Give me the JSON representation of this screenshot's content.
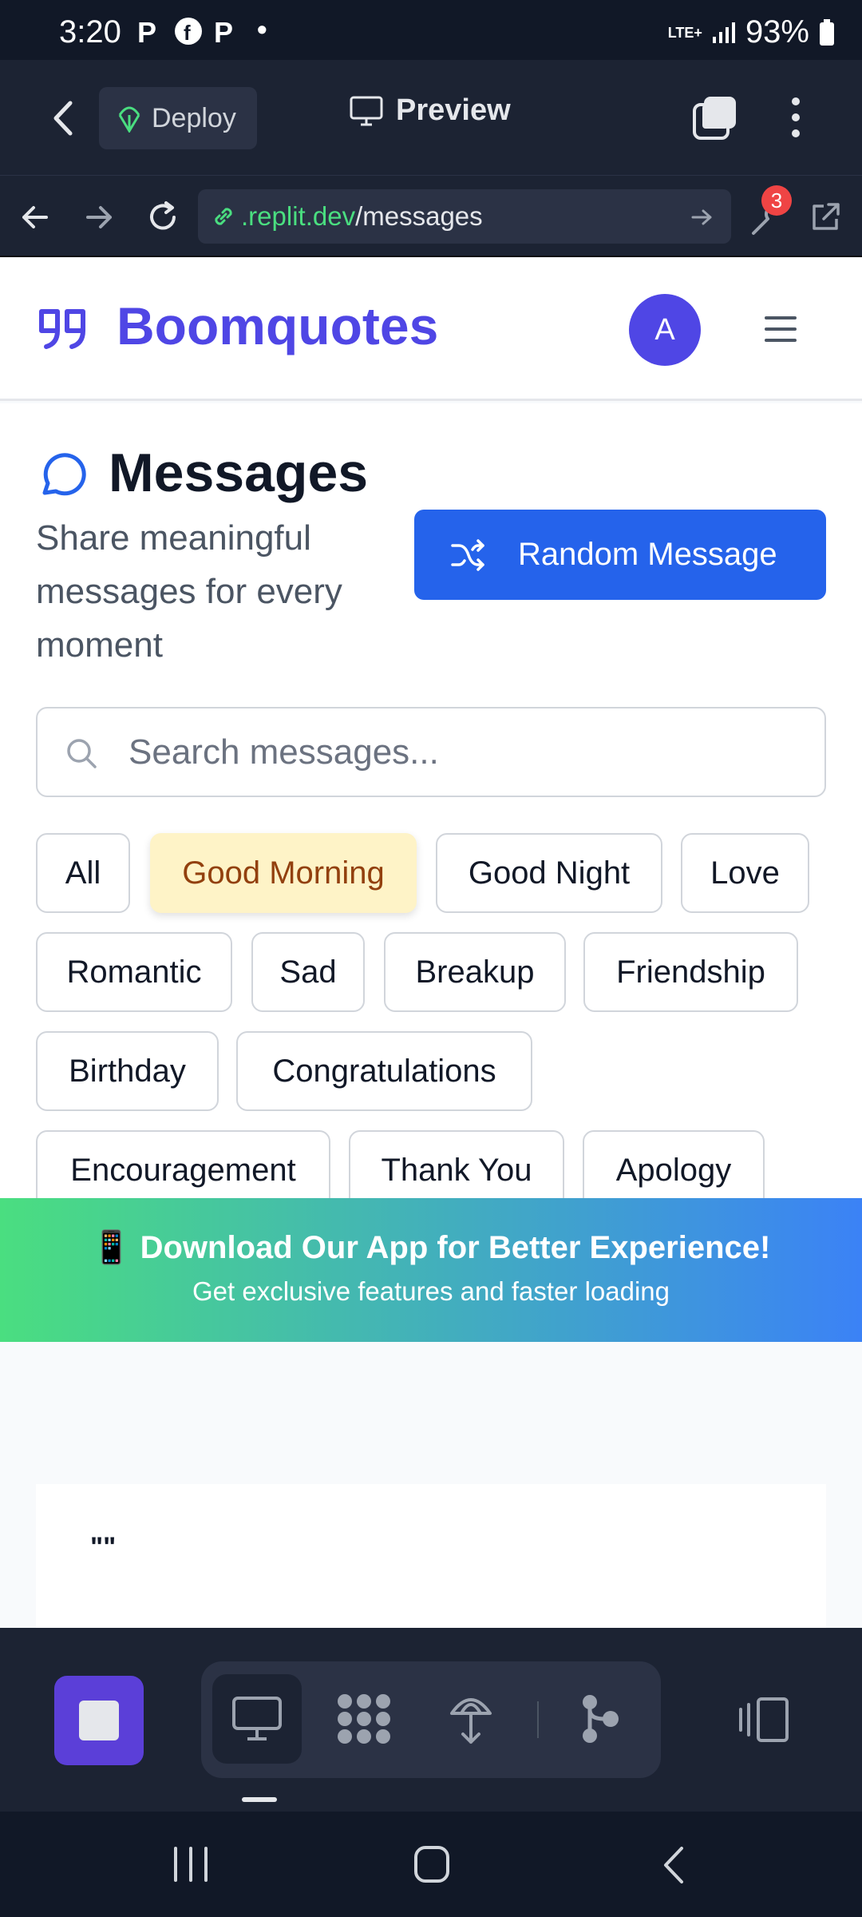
{
  "status_bar": {
    "time": "3:20",
    "network": "LTE+",
    "battery": "93%"
  },
  "replit_toolbar": {
    "deploy_label": "Deploy",
    "preview_label": "Preview"
  },
  "url_bar": {
    "host": ".replit.dev",
    "path": "/messages",
    "badge_count": "3"
  },
  "app": {
    "brand_name": "Boomquotes",
    "avatar_initial": "A"
  },
  "page": {
    "title": "Messages",
    "subtitle": "Share meaningful messages for every moment",
    "random_button": "Random Message",
    "search_placeholder": "Search messages..."
  },
  "categories": [
    {
      "label": "All"
    },
    {
      "label": "Good Morning",
      "active": true
    },
    {
      "label": "Good Night"
    },
    {
      "label": "Love"
    },
    {
      "label": "Romantic"
    },
    {
      "label": "Sad"
    },
    {
      "label": "Breakup"
    },
    {
      "label": "Friendship"
    },
    {
      "label": "Birthday"
    },
    {
      "label": "Congratulations"
    },
    {
      "label": "Encouragement"
    },
    {
      "label": "Thank You"
    },
    {
      "label": "Apology"
    }
  ],
  "banner": {
    "title": "📱 Download Our App for Better Experience!",
    "subtitle": "Get exclusive features and faster loading"
  },
  "quote_card": {
    "text": "\"\""
  },
  "colors": {
    "brand": "#4f46e5",
    "primary_button": "#2563eb",
    "active_chip": "#fef3c7"
  }
}
